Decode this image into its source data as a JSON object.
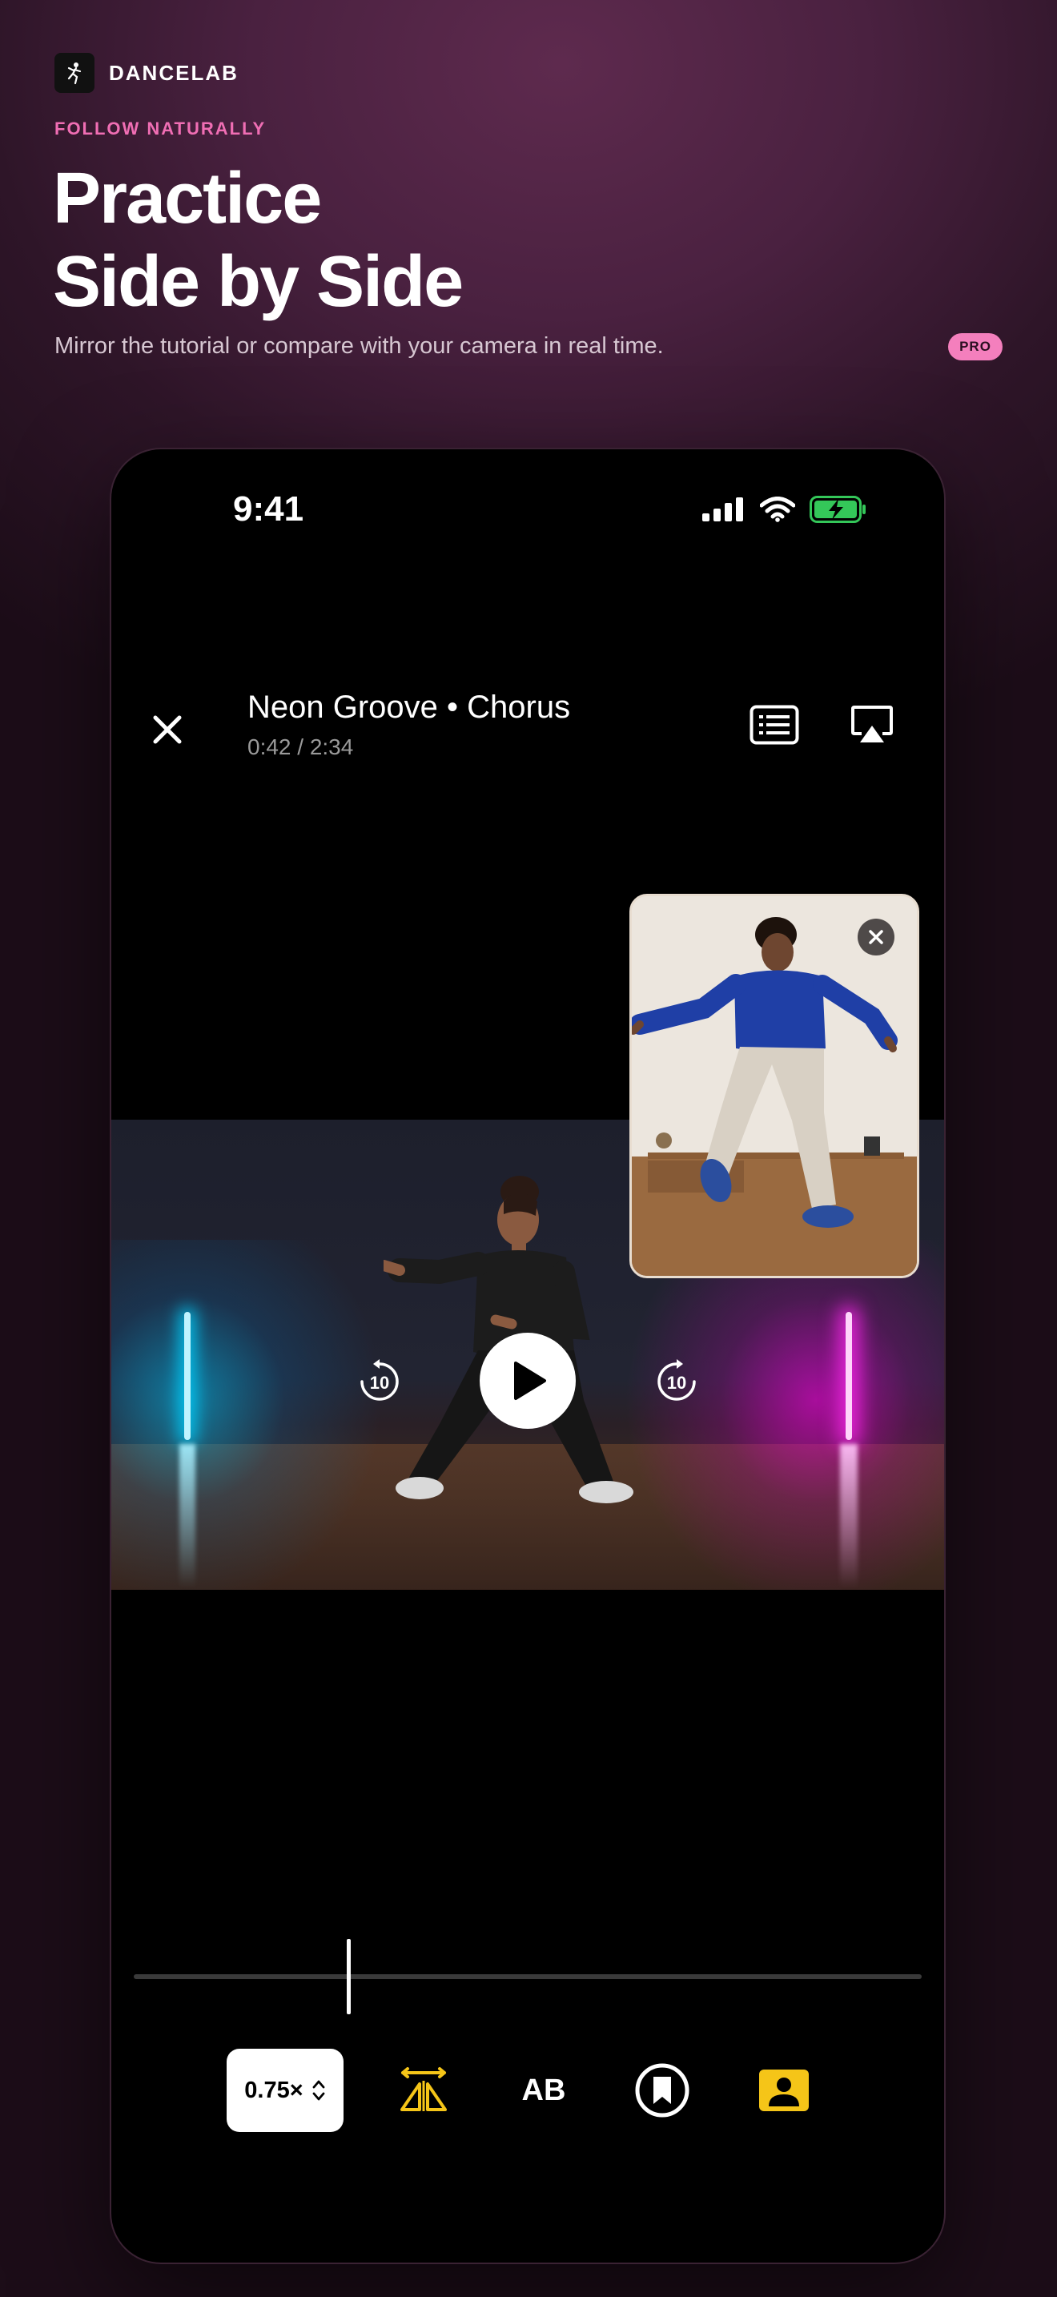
{
  "brand": {
    "name": "DANCELAB",
    "icon": "dancer-icon"
  },
  "hero": {
    "eyebrow": "FOLLOW NATURALLY",
    "headline_line1": "Practice",
    "headline_line2": "Side by Side",
    "subtitle": "Mirror the tutorial or compare with your camera in real time.",
    "badge": "PRO"
  },
  "status_bar": {
    "time": "9:41",
    "icons": [
      "cellular-signal-icon",
      "wifi-icon",
      "battery-charging-icon"
    ]
  },
  "player": {
    "title": "Neon Groove • Chorus",
    "timecode": "0:42 / 2:34",
    "progress_fraction": 0.273,
    "buttons": {
      "close": "close-icon",
      "captions": "captions-icon",
      "airplay": "airplay-icon",
      "rewind": "rewind-10-icon",
      "play": "play-icon",
      "forward": "forward-10-icon",
      "pip_close": "close-icon"
    },
    "skip_seconds": "10"
  },
  "toolbar": {
    "speed_label": "0.75×",
    "mirror": "mirror-flip-icon",
    "ab_label": "AB",
    "bookmark": "bookmark-icon",
    "camera": "camera-person-icon",
    "accent_color": "#f5c518"
  },
  "colors": {
    "accent_pink": "#f06eb4",
    "badge_pink": "#f47fbd",
    "battery_green": "#34c759"
  }
}
